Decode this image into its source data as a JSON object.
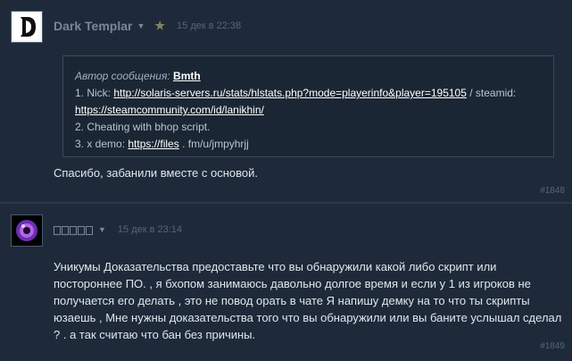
{
  "post1": {
    "author": "Dark Templar",
    "date": "15 дек в 22:38",
    "quote": {
      "label": "Автор сообщения:",
      "author": "Bmth",
      "line1_prefix": "1. Nick: ",
      "line1_link": "http://solaris-servers.ru/stats/hlstats.php?mode=playerinfo&player=195105",
      "line1_suffix": " / steamid:",
      "line2_link": "https://steamcommunity.com/id/lanikhin/",
      "line3": "2. Cheating with bhop script.",
      "line4_prefix": "3. x demo: ",
      "line4_link": "https://files",
      "line4_suffix": " . fm/u/jmpyhrjj"
    },
    "message": "Спасибо, забанили вместе с основой.",
    "post_number": "#1848"
  },
  "post2": {
    "date": "15 дек в 23:14",
    "message": "Уникумы Доказательства предоставьте что вы обнаружили какой либо скрипт или постороннее ПО. , я бхопом занимаюсь давольно долгое время и если у 1 из игроков не получается его делать , это не повод орать в чате Я напишу демку на то что ты скрипты юзаешь , Мне нужны доказательства того что вы обнаружили или вы баните услышал сделал ? . а так считаю что бан без причины.",
    "post_number": "#1849"
  },
  "colors": {
    "background": "#1e2a3a",
    "text": "#c6d4df",
    "link": "#ffffff",
    "muted": "#56657a"
  }
}
